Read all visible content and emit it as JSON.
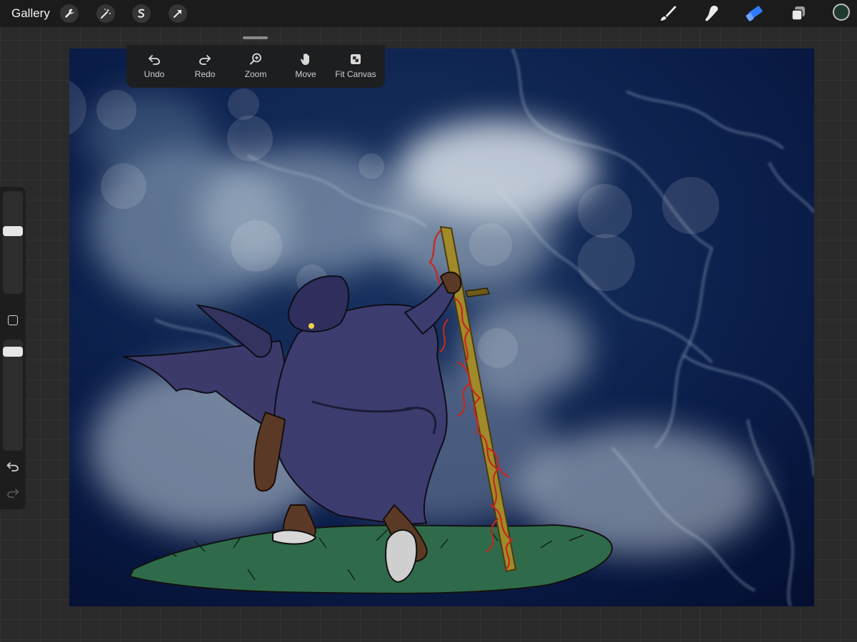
{
  "topbar": {
    "gallery_label": "Gallery",
    "left_tools": [
      "wrench-icon",
      "magic-wand-icon",
      "selection-icon",
      "transform-arrow-icon"
    ],
    "right_tools": [
      "brush-icon",
      "smudge-icon",
      "eraser-icon",
      "layers-icon"
    ],
    "active_tool": "eraser-icon",
    "active_color": "#1f3a2c",
    "accent_color": "#2f7bff"
  },
  "quick_menu": {
    "items": [
      {
        "label": "Undo",
        "icon": "undo-icon"
      },
      {
        "label": "Redo",
        "icon": "redo-icon"
      },
      {
        "label": "Zoom",
        "icon": "zoom-icon"
      },
      {
        "label": "Move",
        "icon": "hand-icon"
      },
      {
        "label": "Fit Canvas",
        "icon": "fit-canvas-icon"
      }
    ]
  },
  "sidebar": {
    "brush_size_level": 0.62,
    "opacity_level": 0.93,
    "icons": [
      "modify-square-icon",
      "undo-icon",
      "redo-icon"
    ]
  },
  "canvas": {
    "colors": {
      "sky": "#06143a",
      "cloud": "#dfe6ee",
      "robe": "#3b3a6a",
      "grass": "#2f6b4a",
      "sword_blade": "#a08a2a",
      "sword_fire": "#c8261b"
    }
  }
}
